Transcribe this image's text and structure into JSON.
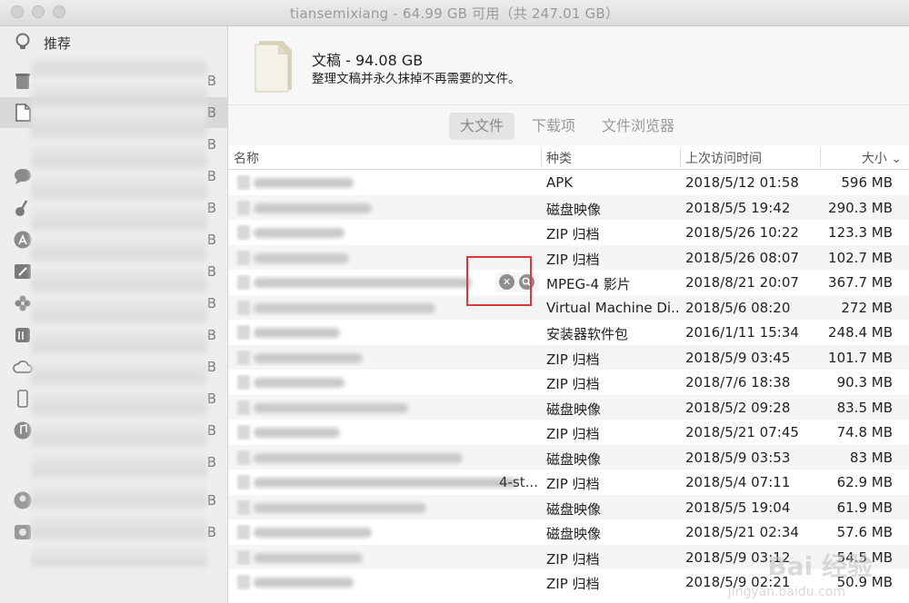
{
  "window": {
    "title": "tiansemixiang - 64.99 GB 可用（共 247.01 GB）"
  },
  "sidebar": {
    "items": [
      {
        "label": "推荐",
        "size": ""
      },
      {
        "label": "",
        "size": "B"
      },
      {
        "label": "",
        "size": "B"
      },
      {
        "label": "",
        "size": "B"
      },
      {
        "label": "",
        "size": "B"
      },
      {
        "label": "",
        "size": "B"
      },
      {
        "label": "",
        "size": "B"
      },
      {
        "label": "",
        "size": "B"
      },
      {
        "label": "",
        "size": "B"
      },
      {
        "label": "",
        "size": "B"
      },
      {
        "label": "",
        "size": "B"
      },
      {
        "label": "",
        "size": "B"
      },
      {
        "label": "",
        "size": "B"
      },
      {
        "label": "",
        "size": "B"
      },
      {
        "label": "",
        "size": "B"
      },
      {
        "label": "",
        "size": "B"
      }
    ]
  },
  "header": {
    "title": "文稿 - 94.08 GB",
    "description": "整理文稿并永久抹掉不再需要的文件。"
  },
  "tabs": [
    {
      "label": "大文件",
      "active": true
    },
    {
      "label": "下载项",
      "active": false
    },
    {
      "label": "文件浏览器",
      "active": false
    }
  ],
  "table": {
    "columns": {
      "name": "名称",
      "kind": "种类",
      "date": "上次访问时间",
      "size": "大小"
    },
    "rows": [
      {
        "name_suffix": "",
        "kind": "APK",
        "date": "2018/5/12 01:58",
        "size": "596 MB"
      },
      {
        "name_suffix": "",
        "kind": "磁盘映像",
        "date": "2018/5/5 19:42",
        "size": "290.3 MB"
      },
      {
        "name_suffix": "",
        "kind": "ZIP 归档",
        "date": "2018/5/26 10:22",
        "size": "123.3 MB"
      },
      {
        "name_suffix": "",
        "kind": "ZIP 归档",
        "date": "2018/5/26 08:07",
        "size": "102.7 MB"
      },
      {
        "name_suffix": "",
        "kind": "MPEG-4 影片",
        "date": "2018/8/21 20:07",
        "size": "367.7 MB"
      },
      {
        "name_suffix": "",
        "kind": "Virtual Machine Di...",
        "date": "2018/5/6 08:20",
        "size": "272 MB"
      },
      {
        "name_suffix": "",
        "kind": "安装器软件包",
        "date": "2016/1/11 15:34",
        "size": "248.4 MB"
      },
      {
        "name_suffix": "",
        "kind": "ZIP 归档",
        "date": "2018/5/9 03:45",
        "size": "101.7 MB"
      },
      {
        "name_suffix": "",
        "kind": "ZIP 归档",
        "date": "2018/7/6 18:38",
        "size": "90.3 MB"
      },
      {
        "name_suffix": "",
        "kind": "磁盘映像",
        "date": "2018/5/2 09:28",
        "size": "83.5 MB"
      },
      {
        "name_suffix": "",
        "kind": "ZIP 归档",
        "date": "2018/5/21 07:45",
        "size": "74.8 MB"
      },
      {
        "name_suffix": "",
        "kind": "磁盘映像",
        "date": "2018/5/9 03:53",
        "size": "83 MB"
      },
      {
        "name_suffix": "4-st...",
        "kind": "ZIP 归档",
        "date": "2018/5/4 07:11",
        "size": "62.9 MB"
      },
      {
        "name_suffix": "",
        "kind": "磁盘映像",
        "date": "2018/5/5 19:04",
        "size": "61.9 MB"
      },
      {
        "name_suffix": "",
        "kind": "磁盘映像",
        "date": "2018/5/21 02:34",
        "size": "57.6 MB"
      },
      {
        "name_suffix": "",
        "kind": "ZIP 归档",
        "date": "2018/5/9 03:12",
        "size": "54.5 MB"
      },
      {
        "name_suffix": "",
        "kind": "ZIP 归档",
        "date": "2018/5/9 02:21",
        "size": "50.9 MB"
      }
    ],
    "hover_row_index": 4
  },
  "watermark": {
    "text": "Bai 经验",
    "sub": "jingyan.baidu.com"
  }
}
